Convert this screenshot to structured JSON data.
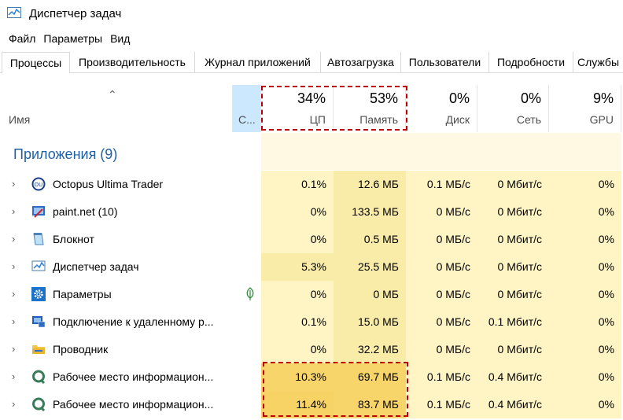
{
  "window": {
    "title": "Диспетчер задач"
  },
  "menu": {
    "items": [
      "Файл",
      "Параметры",
      "Вид"
    ]
  },
  "tabs": [
    "Процессы",
    "Производительность",
    "Журнал приложений",
    "Автозагрузка",
    "Пользователи",
    "Подробности",
    "Службы"
  ],
  "columns": {
    "name": "Имя",
    "status": "С...",
    "cpu": {
      "pct": "34%",
      "label": "ЦП"
    },
    "memory": {
      "pct": "53%",
      "label": "Память"
    },
    "disk": {
      "pct": "0%",
      "label": "Диск"
    },
    "network": {
      "pct": "0%",
      "label": "Сеть"
    },
    "gpu": {
      "pct": "9%",
      "label": "GPU"
    }
  },
  "group": {
    "title": "Приложения (9)"
  },
  "rows": [
    {
      "name": "Octopus Ultima Trader",
      "icon": "octopus-icon",
      "cpu": "0.1%",
      "mem": "12.6 МБ",
      "disk": "0.1 МБ/с",
      "net": "0 Мбит/с",
      "gpu": "0%"
    },
    {
      "name": "paint.net (10)",
      "icon": "paint-icon",
      "cpu": "0%",
      "mem": "133.5 МБ",
      "disk": "0 МБ/с",
      "net": "0 Мбит/с",
      "gpu": "0%"
    },
    {
      "name": "Блокнот",
      "icon": "notepad-icon",
      "cpu": "0%",
      "mem": "0.5 МБ",
      "disk": "0 МБ/с",
      "net": "0 Мбит/с",
      "gpu": "0%"
    },
    {
      "name": "Диспетчер задач",
      "icon": "task-manager-icon",
      "cpu": "5.3%",
      "mem": "25.5 МБ",
      "disk": "0 МБ/с",
      "net": "0 Мбит/с",
      "gpu": "0%"
    },
    {
      "name": "Параметры",
      "icon": "settings-gear-icon",
      "cpu": "0%",
      "mem": "0 МБ",
      "disk": "0 МБ/с",
      "net": "0 Мбит/с",
      "gpu": "0%"
    },
    {
      "name": "Подключение к удаленному р...",
      "icon": "remote-desktop-icon",
      "cpu": "0.1%",
      "mem": "15.0 МБ",
      "disk": "0 МБ/с",
      "net": "0.1 Мбит/с",
      "gpu": "0%"
    },
    {
      "name": "Проводник",
      "icon": "folder-icon",
      "cpu": "0%",
      "mem": "32.2 МБ",
      "disk": "0 МБ/с",
      "net": "0 Мбит/с",
      "gpu": "0%"
    },
    {
      "name": "Рабочее место информацион...",
      "icon": "workplace-icon",
      "cpu": "10.3%",
      "mem": "69.7 МБ",
      "disk": "0.1 МБ/с",
      "net": "0.4 Мбит/с",
      "gpu": "0%"
    },
    {
      "name": "Рабочее место информацион...",
      "icon": "workplace-icon",
      "cpu": "11.4%",
      "mem": "83.7 МБ",
      "disk": "0.1 МБ/с",
      "net": "0.4 Мбит/с",
      "gpu": "0%"
    }
  ],
  "colors": {
    "accent": "#1f5fa6",
    "highlight": "#c00000"
  }
}
